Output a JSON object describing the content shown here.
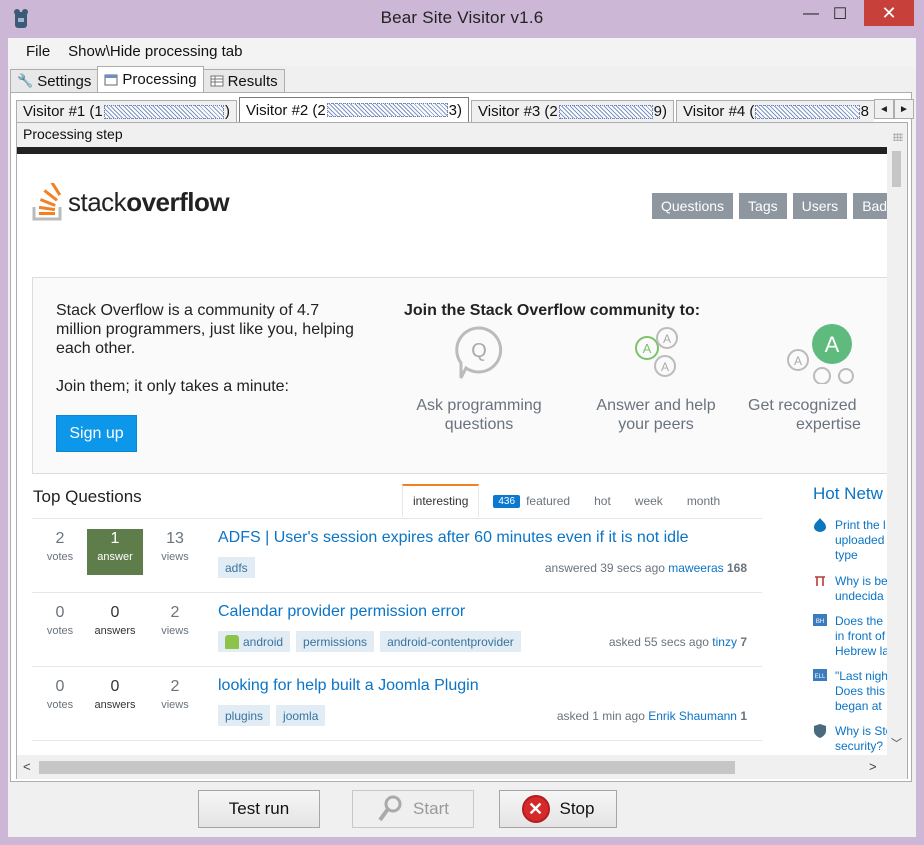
{
  "window": {
    "title": "Bear Site Visitor v1.6",
    "minimize": "—",
    "maximize": "☐",
    "close": "✕"
  },
  "menu": [
    {
      "label": "File"
    },
    {
      "label": "Show\\Hide processing tab"
    }
  ],
  "main_tabs": [
    {
      "label": "Settings",
      "icon": "wrench-icon"
    },
    {
      "label": "Processing",
      "icon": "processing-icon",
      "active": true
    },
    {
      "label": "Results",
      "icon": "table-icon"
    }
  ],
  "visitor_tabs": [
    {
      "prefix": "Visitor #1 (1",
      "suffix": ")"
    },
    {
      "prefix": "Visitor #2 (2",
      "suffix": "3)",
      "active": true
    },
    {
      "prefix": "Visitor #3 (2",
      "suffix": "9)"
    },
    {
      "prefix": "Visitor #4 (",
      "suffix": "8"
    }
  ],
  "visitor_scroll": {
    "left": "◄",
    "right": "►"
  },
  "processing": {
    "step_label": "Processing step"
  },
  "browser": {
    "logo_light": "stack",
    "logo_bold": "overflow",
    "nav": [
      {
        "label": "Questions"
      },
      {
        "label": "Tags"
      },
      {
        "label": "Users"
      },
      {
        "label": "Bad"
      }
    ],
    "hero": {
      "text": "Stack Overflow is a community of 4.7 million programmers, just like you, helping each other.",
      "join": "Join them; it only takes a minute:",
      "signup": "Sign up",
      "heading": "Join the Stack Overflow community to:",
      "features": [
        {
          "line1": "Ask programming",
          "line2": "questions"
        },
        {
          "line1": "Answer and help",
          "line2": "your peers"
        },
        {
          "line1": "Get recognized",
          "line2": "expertise"
        }
      ]
    },
    "top_questions_title": "Top Questions",
    "question_tabs": [
      {
        "label": "interesting",
        "active": true
      },
      {
        "label": "featured",
        "badge": "436"
      },
      {
        "label": "hot"
      },
      {
        "label": "week"
      },
      {
        "label": "month"
      }
    ],
    "questions": [
      {
        "votes": "2",
        "votes_label": "votes",
        "answers": "1",
        "answers_label": "answer",
        "views": "13",
        "views_label": "views",
        "title": "ADFS | User's session expires after 60 minutes even if it is not idle",
        "tags": [
          "adfs"
        ],
        "meta_action": "answered 39 secs ago",
        "user": "maweeras",
        "rep": "168"
      },
      {
        "votes": "0",
        "votes_label": "votes",
        "answers": "0",
        "answers_label": "answers",
        "views": "2",
        "views_label": "views",
        "title": "Calendar provider permission error",
        "tags": [
          "android",
          "permissions",
          "android-contentprovider"
        ],
        "meta_action": "asked 55 secs ago",
        "user": "tinzy",
        "rep": "7"
      },
      {
        "votes": "0",
        "votes_label": "votes",
        "answers": "0",
        "answers_label": "answers",
        "views": "2",
        "views_label": "views",
        "title": "looking for help built a Joomla Plugin",
        "tags": [
          "plugins",
          "joomla"
        ],
        "meta_action": "asked 1 min ago",
        "user": "Enrik Shaumann",
        "rep": "1"
      }
    ],
    "hot_title": "Hot Netw",
    "hot_items": [
      {
        "lines": [
          "Print the l",
          "uploaded",
          "type"
        ],
        "icon": "drupal-icon"
      },
      {
        "lines": [
          "Why is be",
          "undecida"
        ],
        "icon": "math-icon"
      },
      {
        "lines": [
          "Does the",
          "in front of",
          "Hebrew la"
        ],
        "icon": "bh-icon"
      },
      {
        "lines": [
          "\"Last nigh",
          "Does this",
          "began at"
        ],
        "icon": "ell-icon"
      },
      {
        "lines": [
          "Why is Sto",
          "security?"
        ],
        "icon": "security-icon"
      }
    ]
  },
  "bottom_buttons": {
    "test_run": "Test run",
    "start": "Start",
    "stop": "Stop"
  }
}
